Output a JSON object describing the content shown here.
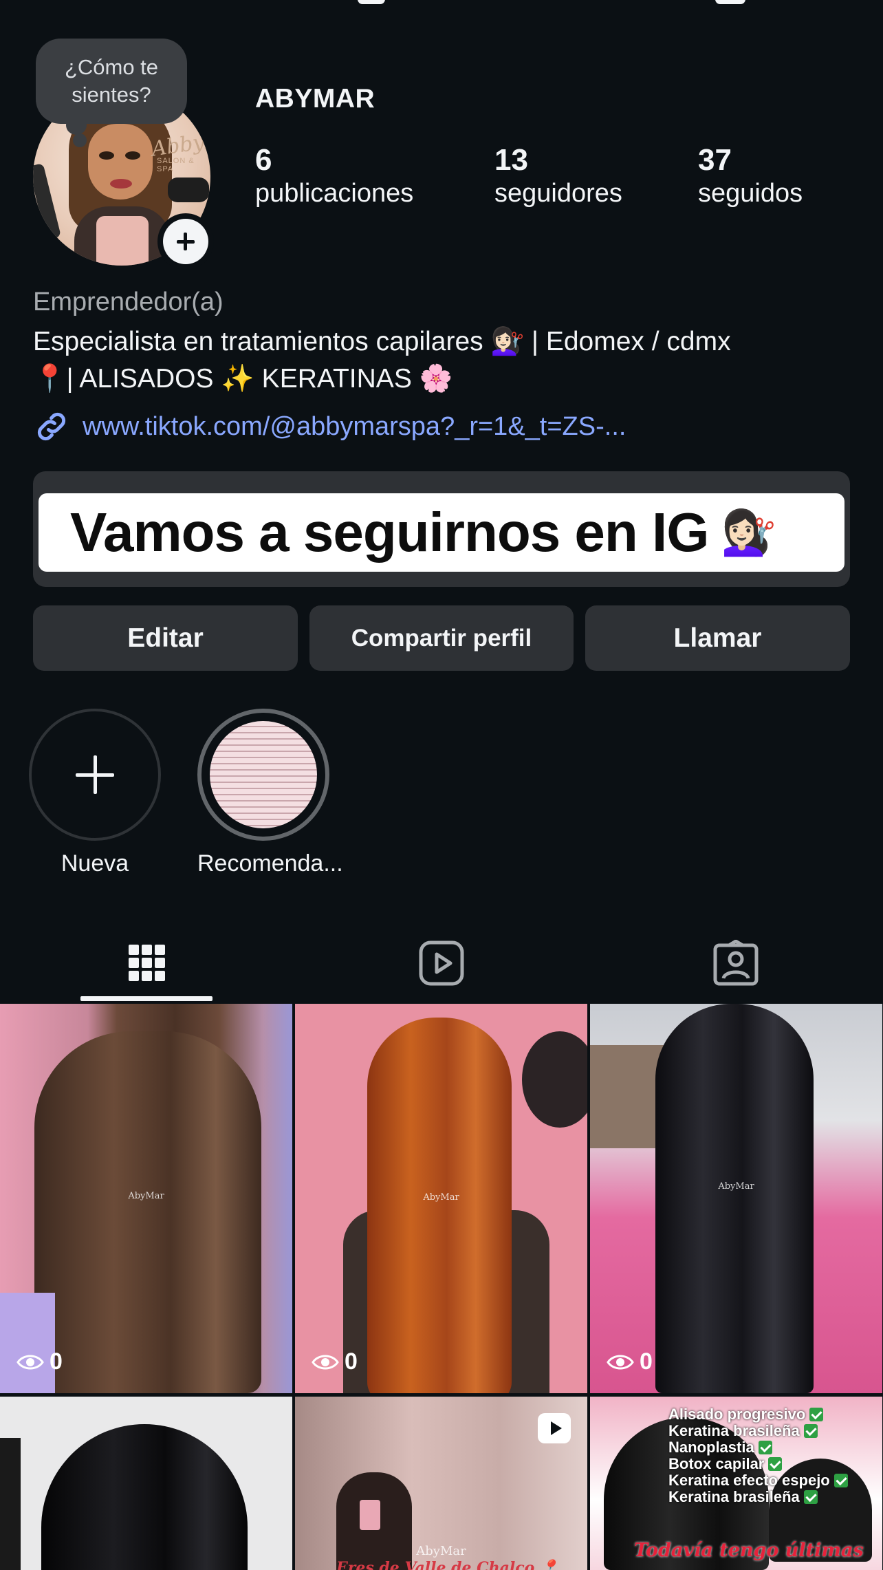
{
  "profile": {
    "username": "ABYMAR",
    "note": "¿Cómo te sientes?",
    "avatar_brand": "AbbyMar",
    "avatar_brand_sub": "SALON & SPA",
    "stats": [
      {
        "value": "6",
        "label": "publicaciones"
      },
      {
        "value": "13",
        "label": "seguidores"
      },
      {
        "value": "37",
        "label": "seguidos"
      }
    ],
    "category": "Emprendedor(a)",
    "bio_line1": "Especialista en tratamientos capilares 💇🏻‍♀️ | Edomex / cdmx",
    "bio_line2": "📍| ALISADOS ✨ KERATINAS 🌸",
    "link": "www.tiktok.com/@abbymarspa?_r=1&_t=ZS-...",
    "banner_text": "Vamos a seguirnos en IG",
    "banner_emoji": "💇🏻‍♀️"
  },
  "buttons": {
    "edit": "Editar",
    "share": "Compartir perfil",
    "call": "Llamar"
  },
  "highlights": [
    {
      "label": "Nueva"
    },
    {
      "label": "Recomenda..."
    }
  ],
  "tabs": [
    {
      "icon": "grid-icon",
      "active": true
    },
    {
      "icon": "reels-icon",
      "active": false
    },
    {
      "icon": "tagged-icon",
      "active": false
    }
  ],
  "posts": [
    {
      "watermark": "AbyMar",
      "views": "0",
      "colors": [
        "#5a3b2e",
        "#e4a7b9"
      ]
    },
    {
      "watermark": "AbyMar",
      "views": "0",
      "colors": [
        "#b5511f",
        "#e68fa0"
      ]
    },
    {
      "watermark": "AbyMar",
      "views": "0",
      "colors": [
        "#141418",
        "#e46aa0"
      ]
    },
    {
      "watermark": "",
      "views": "",
      "colors": [
        "#0e0e10",
        "#e9e9ea"
      ]
    },
    {
      "watermark": "AbyMar",
      "views": "",
      "caption": "Eres de Valle de Chalco 📍",
      "is_reel": true,
      "colors": [
        "#b99a96",
        "#d9bdb9"
      ]
    },
    {
      "watermark": "",
      "views": "",
      "checklist": [
        "Alisado progresivo",
        "Keratina brasileña",
        "Nanoplastia",
        "Botox capilar",
        "Keratina efecto espejo",
        "Keratina brasileña"
      ],
      "promo": "Todavía tengo últimas",
      "colors": [
        "#151515",
        "#f1b3c6"
      ]
    }
  ],
  "colors": {
    "background": "#0b1014",
    "button": "#2e3135",
    "link": "#8aa8ff",
    "text": "#f3f5f7",
    "muted": "#a8acb0"
  }
}
